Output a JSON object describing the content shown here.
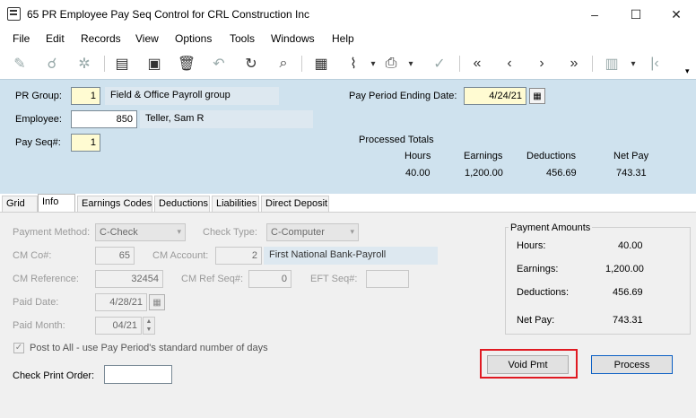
{
  "window": {
    "title": "65 PR Employee Pay Seq Control for CRL Construction Inc",
    "minimize": "–",
    "maximize": "☐",
    "close": "✕"
  },
  "menu": [
    "File",
    "Edit",
    "Records",
    "View",
    "Options",
    "Tools",
    "Windows",
    "Help"
  ],
  "header": {
    "pr_group_label": "PR Group:",
    "pr_group_value": "1",
    "pr_group_desc": "Field & Office Payroll group",
    "employee_label": "Employee:",
    "employee_value": "850",
    "employee_name": "Teller, Sam R",
    "pay_seq_label": "Pay Seq#:",
    "pay_seq_value": "1",
    "pay_period_label": "Pay Period Ending Date:",
    "pay_period_value": "4/24/21",
    "processed_totals_label": "Processed Totals",
    "totals": {
      "hours_label": "Hours",
      "earnings_label": "Earnings",
      "deductions_label": "Deductions",
      "netpay_label": "Net Pay",
      "hours": "40.00",
      "earnings": "1,200.00",
      "deductions": "456.69",
      "netpay": "743.31"
    }
  },
  "tabs": [
    "Grid",
    "Info",
    "Earnings Codes",
    "Deductions",
    "Liabilities",
    "Direct Deposit"
  ],
  "info": {
    "payment_method_label": "Payment Method:",
    "payment_method_value": "C-Check",
    "check_type_label": "Check Type:",
    "check_type_value": "C-Computer",
    "cm_co_label": "CM Co#:",
    "cm_co_value": "65",
    "cm_account_label": "CM Account:",
    "cm_account_value": "2",
    "cm_account_desc": "First National Bank-Payroll",
    "cm_reference_label": "CM Reference:",
    "cm_reference_value": "32454",
    "cm_ref_seq_label": "CM Ref Seq#:",
    "cm_ref_seq_value": "0",
    "eft_seq_label": "EFT Seq#:",
    "eft_seq_value": "",
    "paid_date_label": "Paid Date:",
    "paid_date_value": "4/28/21",
    "paid_month_label": "Paid Month:",
    "paid_month_value": "04/21",
    "post_to_all_label": "Post to All - use Pay Period's standard number of days",
    "check_print_order_label": "Check Print Order:",
    "check_print_order_value": ""
  },
  "payment_amounts": {
    "title": "Payment Amounts",
    "hours_label": "Hours:",
    "hours": "40.00",
    "earnings_label": "Earnings:",
    "earnings": "1,200.00",
    "deductions_label": "Deductions:",
    "deductions": "456.69",
    "netpay_label": "Net Pay:",
    "netpay": "743.31"
  },
  "buttons": {
    "void_pmt": "Void Pmt",
    "process": "Process"
  },
  "colors": {
    "header_bg": "#cfe2ee",
    "highlight": "#e01a22",
    "required_field": "#fffbd2"
  }
}
